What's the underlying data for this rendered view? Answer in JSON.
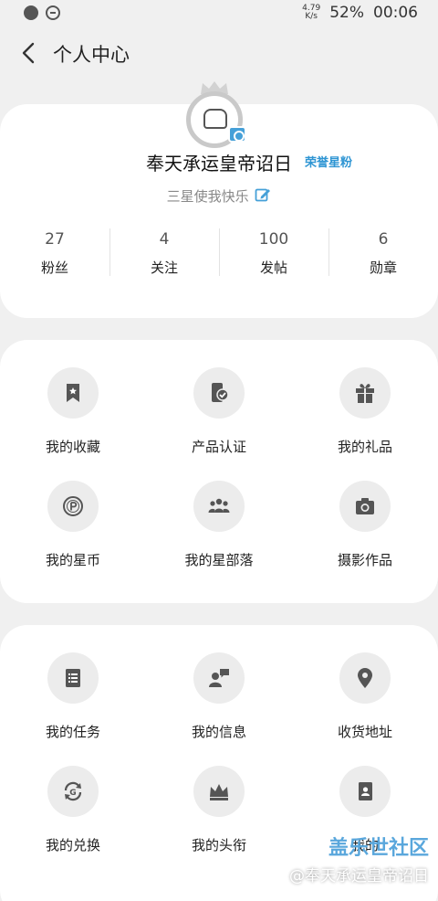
{
  "status_bar": {
    "speed_value": "4.79",
    "speed_unit": "K/s",
    "battery": "52%",
    "time": "00:06"
  },
  "header": {
    "title": "个人中心"
  },
  "profile": {
    "username": "奉天承运皇帝诏日",
    "badge": "荣誉星粉",
    "signature": "三星使我快乐",
    "stats": [
      {
        "value": "27",
        "label": "粉丝"
      },
      {
        "value": "4",
        "label": "关注"
      },
      {
        "value": "100",
        "label": "发帖"
      },
      {
        "value": "6",
        "label": "勋章"
      }
    ]
  },
  "features": [
    {
      "label": "我的收藏",
      "icon": "bookmark-icon"
    },
    {
      "label": "产品认证",
      "icon": "phone-check-icon"
    },
    {
      "label": "我的礼品",
      "icon": "gift-icon"
    },
    {
      "label": "我的星币",
      "icon": "coin-icon"
    },
    {
      "label": "我的星部落",
      "icon": "group-icon"
    },
    {
      "label": "摄影作品",
      "icon": "camera-icon"
    }
  ],
  "services": [
    {
      "label": "我的任务",
      "icon": "task-list-icon"
    },
    {
      "label": "我的信息",
      "icon": "message-user-icon"
    },
    {
      "label": "收货地址",
      "icon": "location-pin-icon"
    },
    {
      "label": "我的兑换",
      "icon": "exchange-icon"
    },
    {
      "label": "我的头衔",
      "icon": "crown-icon"
    },
    {
      "label": "我的",
      "icon": "id-card-icon"
    }
  ],
  "watermark": {
    "brand": "盖乐世社区",
    "user": "@奉天承运皇帝诏日"
  },
  "colors": {
    "accent_blue": "#2e95d3",
    "background": "#f0f0f0",
    "icon_circle": "#ececec",
    "icon_gray": "#555555"
  }
}
